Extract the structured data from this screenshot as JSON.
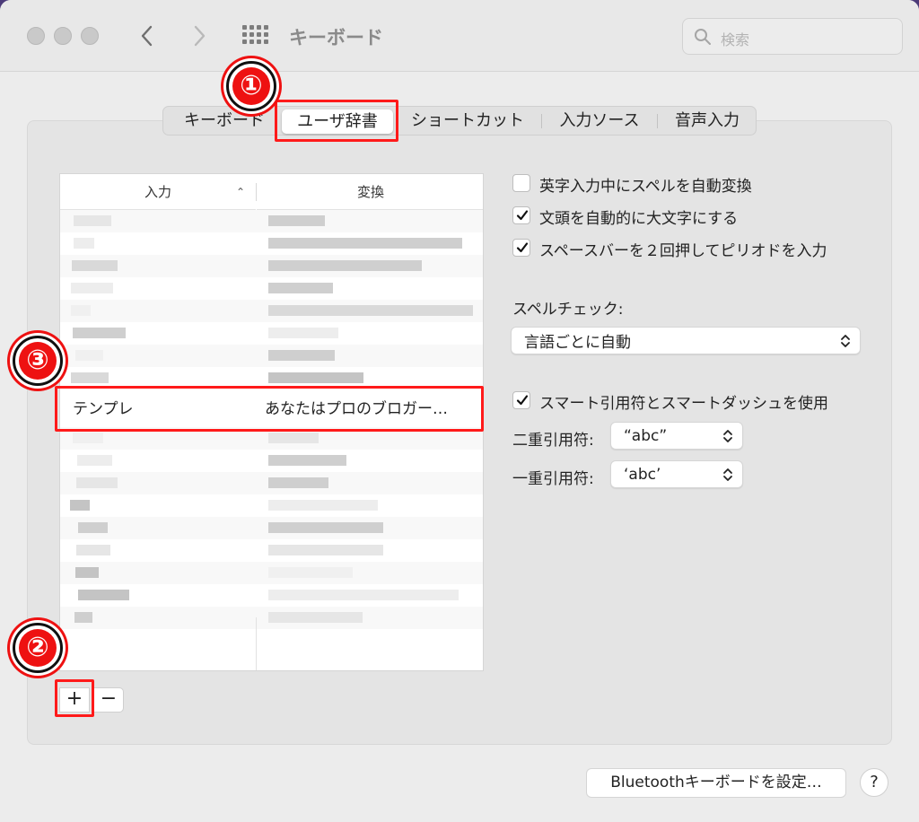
{
  "window": {
    "title": "キーボード"
  },
  "search": {
    "placeholder": "検索"
  },
  "tabs": [
    "キーボード",
    "ユーザ辞書",
    "ショートカット",
    "入力ソース",
    "音声入力"
  ],
  "dictionary": {
    "col_input": "入力",
    "col_output": "変換",
    "selected_row": {
      "input": "テンプレ",
      "output": "あなたはプロのブロガー…"
    }
  },
  "add_button": "+",
  "remove_button": "−",
  "options": {
    "autocorrect": {
      "label": "英字入力中にスペルを自動変換",
      "checked": false
    },
    "capitalize": {
      "label": "文頭を自動的に大文字にする",
      "checked": true
    },
    "period": {
      "label": "スペースバーを２回押してピリオドを入力",
      "checked": true
    },
    "spellcheck_label": "スペルチェック:",
    "spellcheck_value": "言語ごとに自動",
    "smart_quotes": {
      "label": "スマート引用符とスマートダッシュを使用",
      "checked": true
    },
    "double_label": "二重引用符:",
    "double_value": "“abc”",
    "single_label": "一重引用符:",
    "single_value": "‘abc’"
  },
  "bluetooth_button": "Bluetoothキーボードを設定…",
  "help_button": "?",
  "annotations": [
    "①",
    "②",
    "③"
  ],
  "colors": {
    "annotation_red": "#ff1a1a",
    "window_bg": "#ececec"
  }
}
